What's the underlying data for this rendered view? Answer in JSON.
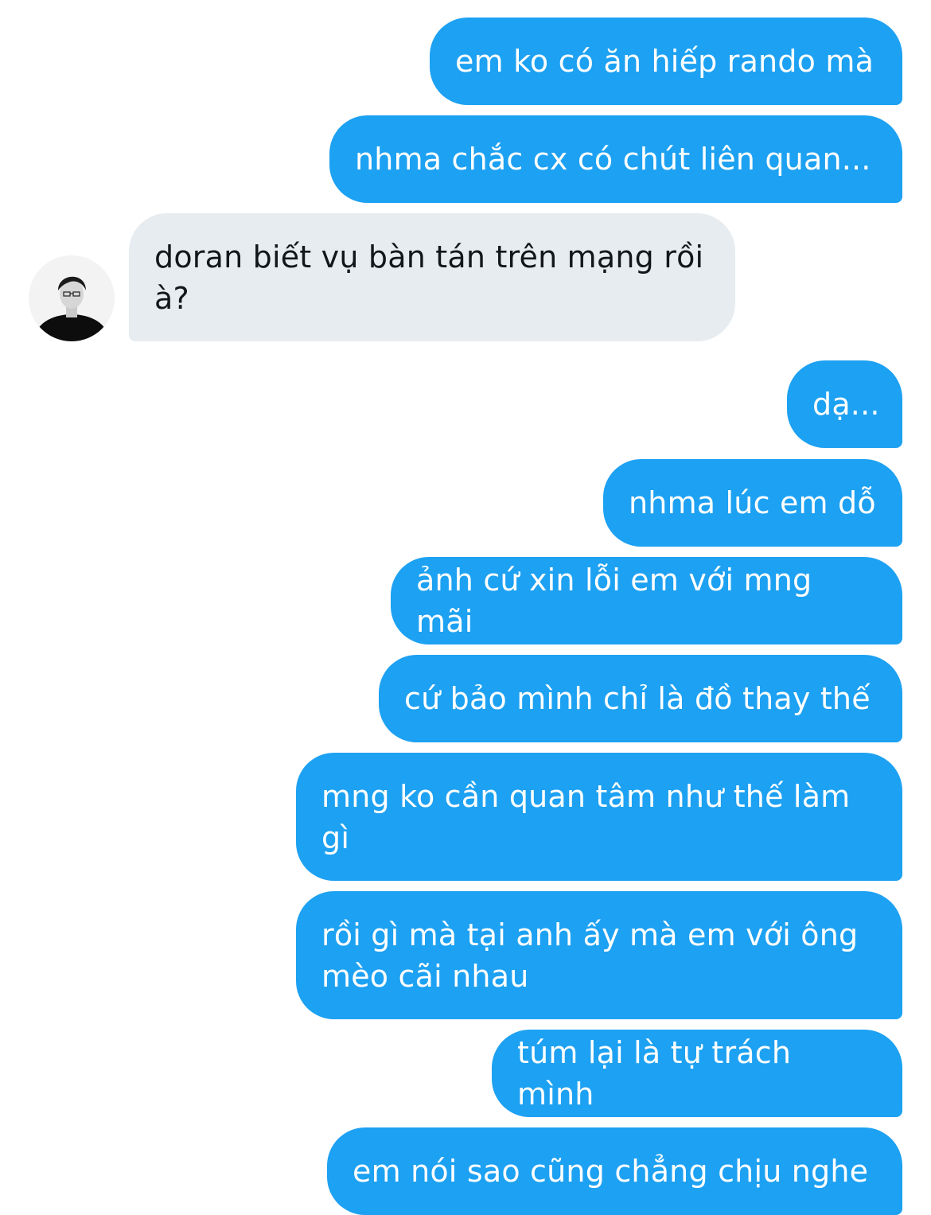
{
  "conversation": {
    "messages": [
      {
        "side": "out",
        "text": "em ko có ăn hiếp rando mà"
      },
      {
        "side": "out",
        "text": "nhma chắc cx có chút liên quan..."
      },
      {
        "side": "in",
        "text": "doran biết vụ bàn tán trên mạng rồi\nà?"
      },
      {
        "side": "out",
        "text": "dạ..."
      },
      {
        "side": "out",
        "text": "nhma lúc em dỗ"
      },
      {
        "side": "out",
        "text": "ảnh cứ xin lỗi em với mng mãi"
      },
      {
        "side": "out",
        "text": "cứ bảo mình chỉ là đồ thay thế"
      },
      {
        "side": "out",
        "text": "mng ko cần quan tâm như thế làm\ngì"
      },
      {
        "side": "out",
        "text": "rồi gì mà tại anh ấy mà em với ông\nmèo cãi nhau"
      },
      {
        "side": "out",
        "text": "túm lại là tự trách mình"
      },
      {
        "side": "out",
        "text": "em nói sao cũng chẳng chịu nghe"
      }
    ],
    "avatar_icon": "user-avatar-icon"
  }
}
